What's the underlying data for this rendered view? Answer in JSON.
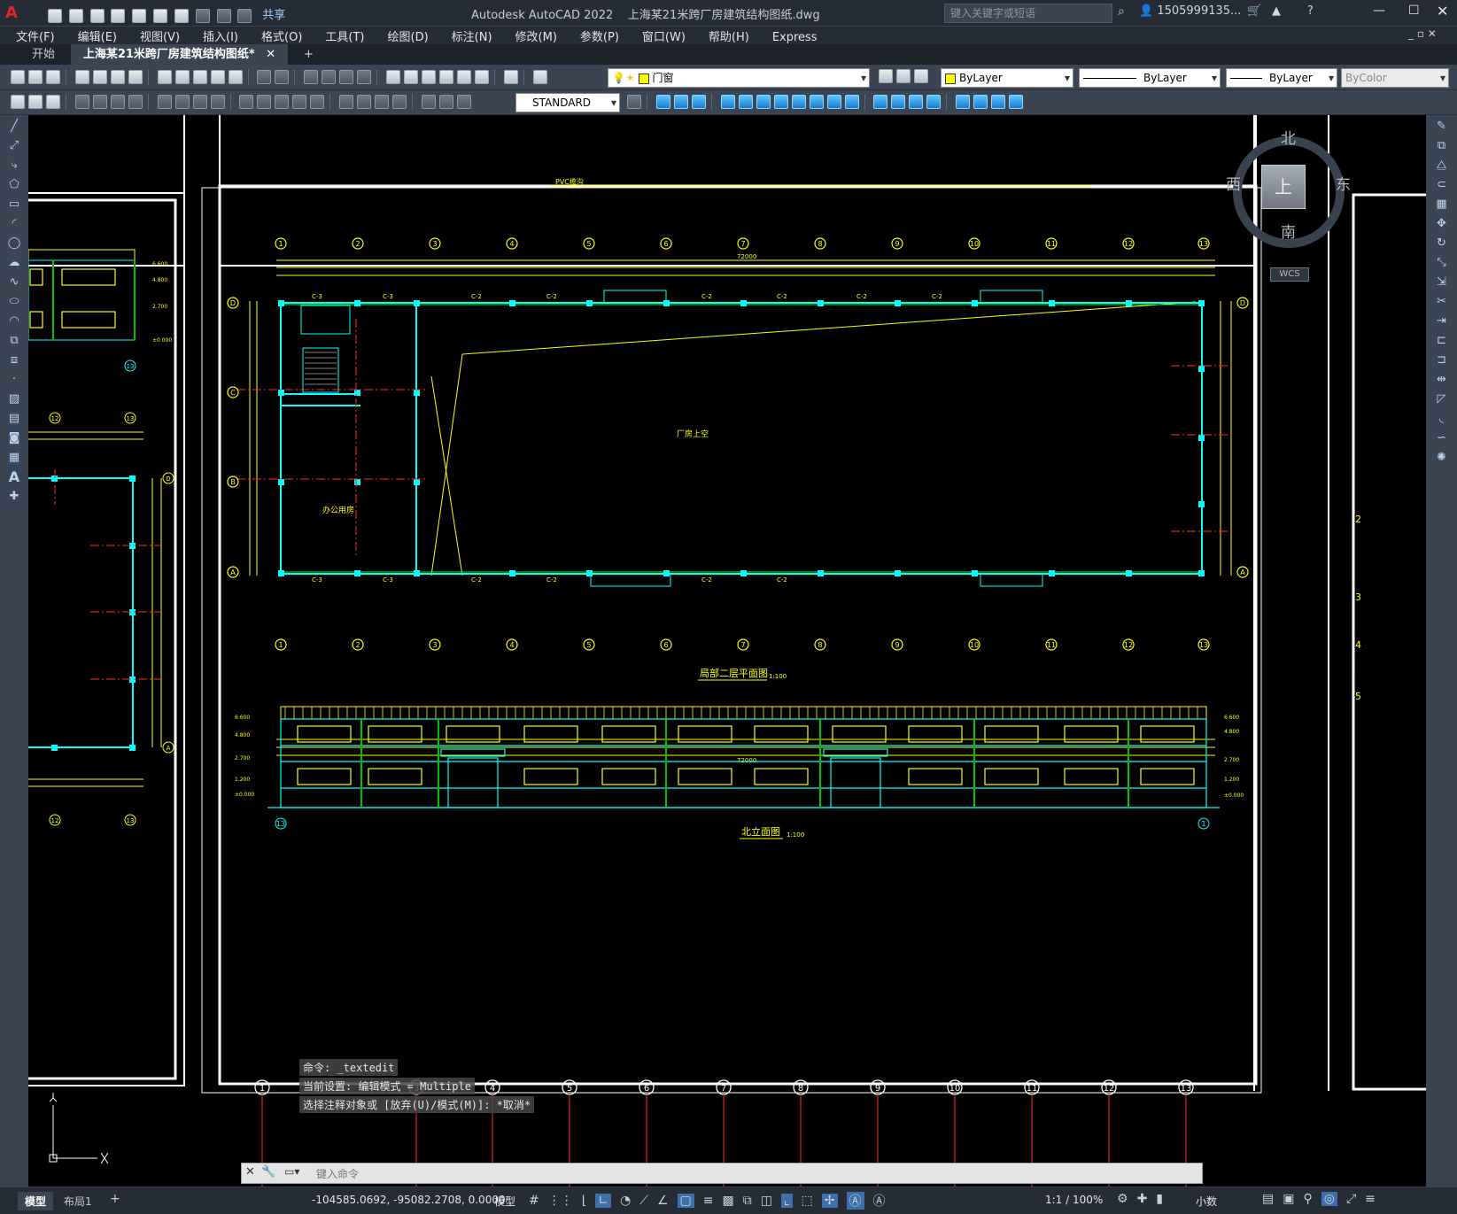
{
  "app": {
    "title": "Autodesk AutoCAD 2022",
    "file": "上海某21米跨厂房建筑结构图纸.dwg",
    "share": "共享",
    "search_placeholder": "键入关键字或短语",
    "user": "1505999135...",
    "logo": "A"
  },
  "menu": [
    "文件(F)",
    "编辑(E)",
    "视图(V)",
    "插入(I)",
    "格式(O)",
    "工具(T)",
    "绘图(D)",
    "标注(N)",
    "修改(M)",
    "参数(P)",
    "窗口(W)",
    "帮助(H)",
    "Express"
  ],
  "tabs": [
    "开始",
    "上海某21米跨厂房建筑结构图纸*"
  ],
  "props": {
    "layer": "门窗",
    "color": "ByLayer",
    "linetype": "ByLayer",
    "lineweight": "ByLayer",
    "plotstyle": "ByColor",
    "textstyle": "STANDARD"
  },
  "viewcube": {
    "north": "北",
    "south": "南",
    "east": "东",
    "west": "西",
    "top": "上",
    "wcs": "WCS"
  },
  "drawing": {
    "plan_title": "局部二层平面图",
    "plan_scale": "1:100",
    "elev_title": "北立面图",
    "elev_scale": "1:100",
    "room_factory": "厂房上空",
    "room_office": "办公用房",
    "axis_numbers": [
      "1",
      "2",
      "3",
      "4",
      "5",
      "6",
      "7",
      "8",
      "9",
      "10",
      "11",
      "12",
      "13"
    ],
    "axis_letters": [
      "D",
      "C",
      "B",
      "A"
    ],
    "total_dim": "72000",
    "window_tags": [
      "C-3",
      "C-3",
      "C-2",
      "C-2",
      "C-2",
      "C-2",
      "C-2",
      "C-2",
      "C-2",
      "C-2",
      "C-2",
      "C-2"
    ],
    "top_note": "PVC檐沟",
    "elev_levels": [
      "6.600",
      "4.800",
      "2.700",
      "1.200",
      "±0.000"
    ],
    "side_levels": [
      "6.600",
      "4.800",
      "2.700",
      "±0.000"
    ],
    "side_axes": [
      "12",
      "13"
    ],
    "bottom_axes": [
      "1",
      "3",
      "4",
      "5",
      "6",
      "7",
      "8",
      "9",
      "10",
      "11",
      "12",
      "13"
    ]
  },
  "command": {
    "lines": [
      "命令: _textedit",
      "当前设置: 编辑模式 = Multiple",
      "选择注释对象或 [放弃(U)/模式(M)]: *取消*"
    ],
    "placeholder": "键入命令"
  },
  "status": {
    "coords": "-104585.0692, -95082.2708, 0.0000",
    "model": "模型",
    "scale": "1:1 / 100%",
    "units": "小数",
    "layout_tabs": [
      "模型",
      "布局1"
    ]
  }
}
